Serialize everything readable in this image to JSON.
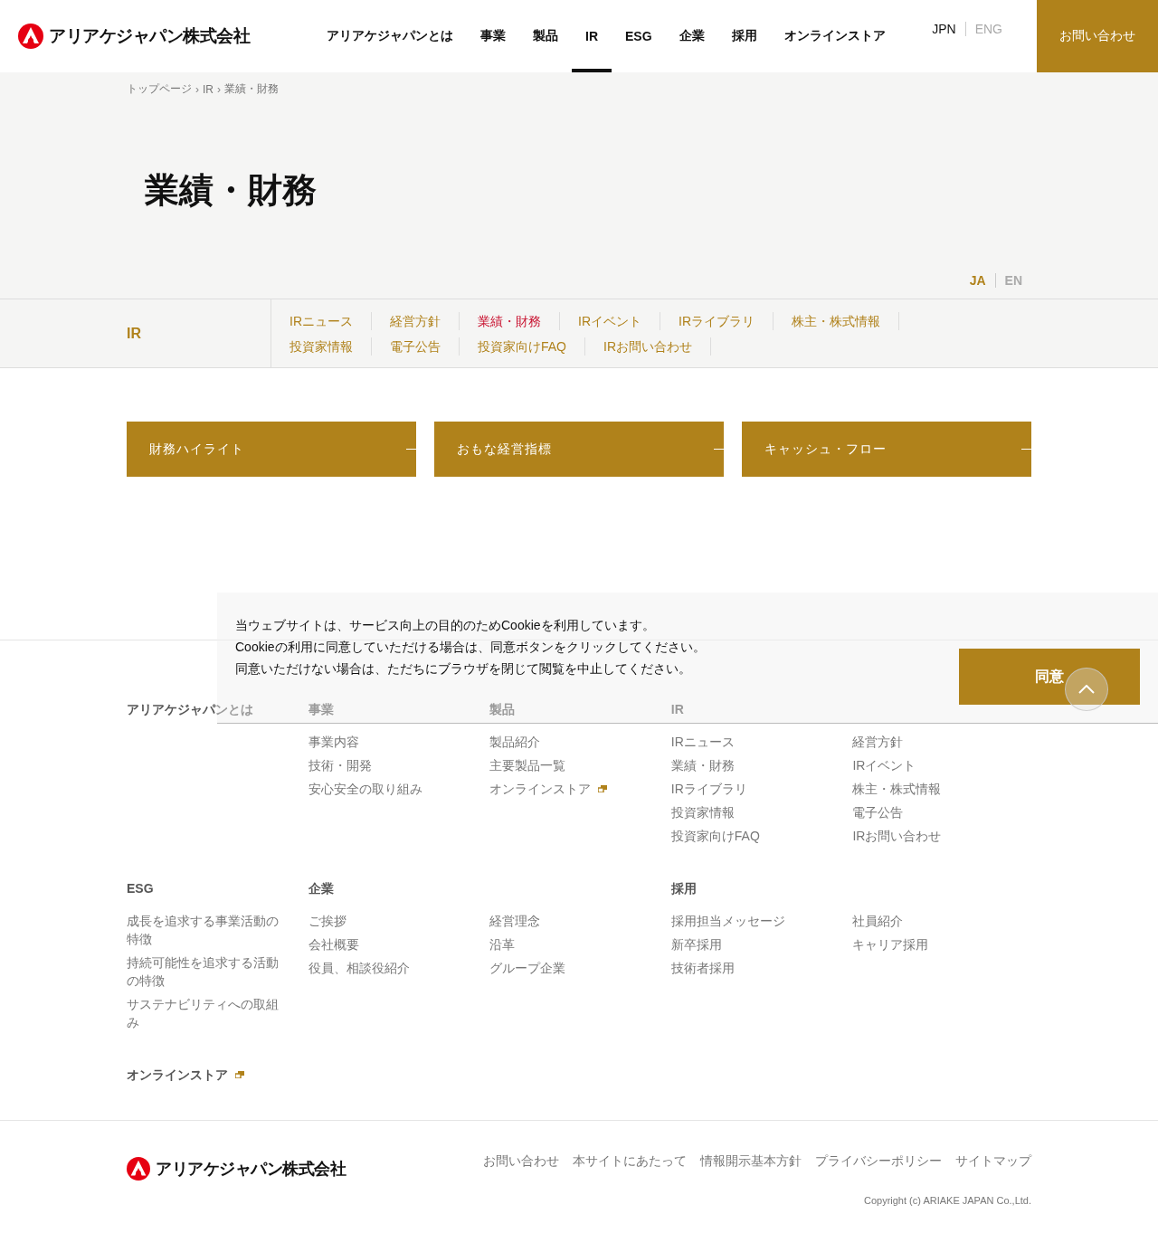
{
  "header": {
    "logo_text": "アリアケジャパン株式会社",
    "nav": [
      {
        "label": "アリアケジャパンとは",
        "selected": false
      },
      {
        "label": "事業",
        "selected": false
      },
      {
        "label": "製品",
        "selected": false
      },
      {
        "label": "IR",
        "selected": true
      },
      {
        "label": "ESG",
        "selected": false
      },
      {
        "label": "企業",
        "selected": false
      },
      {
        "label": "採用",
        "selected": false
      },
      {
        "label": "オンラインストア",
        "selected": false
      }
    ],
    "languages": [
      {
        "label": "JPN",
        "selected": true
      },
      {
        "label": "ENG",
        "selected": false
      }
    ],
    "contact_button": "お問い合わせ"
  },
  "hero": {
    "breadcrumb": [
      "トップページ",
      "IR",
      "業績・財務"
    ],
    "breadcrumb_separator": "›",
    "title": "業績・財務",
    "languages": [
      {
        "label": "JA",
        "selected": true
      },
      {
        "label": "EN",
        "selected": false
      }
    ]
  },
  "subnav": {
    "title": "IR",
    "rows": [
      [
        {
          "label": "IRニュース",
          "selected": false
        },
        {
          "label": "経営方針",
          "selected": false
        },
        {
          "label": "業績・財務",
          "selected": true
        },
        {
          "label": "IRイベント",
          "selected": false
        },
        {
          "label": "IRライブラリ",
          "selected": false
        },
        {
          "label": "株主・株式情報",
          "selected": false
        }
      ],
      [
        {
          "label": "投資家情報",
          "selected": false
        },
        {
          "label": "電子公告",
          "selected": false
        },
        {
          "label": "投資家向けFAQ",
          "selected": false
        },
        {
          "label": "IRお問い合わせ",
          "selected": false
        }
      ]
    ]
  },
  "cards": [
    "財務ハイライト",
    "おもな経営指標",
    "キャッシュ・フロー"
  ],
  "footer_nav": [
    [
      {
        "heading": "アリアケジャパンとは"
      },
      {
        "heading": "事業",
        "columns": [
          [
            {
              "label": "事業内容",
              "external": false
            },
            {
              "label": "技術・開発",
              "external": false
            },
            {
              "label": "安心安全の取り組み",
              "external": false
            }
          ]
        ]
      },
      {
        "heading": "製品",
        "columns": [
          [
            {
              "label": "製品紹介",
              "external": false
            },
            {
              "label": "主要製品一覧",
              "external": false
            },
            {
              "label": "オンラインストア",
              "external": true
            }
          ]
        ]
      },
      {
        "heading": "IR",
        "columns": [
          [
            {
              "label": "IRニュース",
              "external": false
            },
            {
              "label": "業績・財務",
              "external": false
            },
            {
              "label": "IRライブラリ",
              "external": false
            },
            {
              "label": "投資家情報",
              "external": false
            },
            {
              "label": "投資家向けFAQ",
              "external": false
            }
          ],
          [
            {
              "label": "経営方針",
              "external": false
            },
            {
              "label": "IRイベント",
              "external": false
            },
            {
              "label": "株主・株式情報",
              "external": false
            },
            {
              "label": "電子公告",
              "external": false
            },
            {
              "label": "IRお問い合わせ",
              "external": false
            }
          ]
        ]
      }
    ],
    [
      {
        "heading": "ESG",
        "columns": [
          [
            {
              "label": "成長を追求する事業活動の特徴",
              "external": false
            },
            {
              "label": "持続可能性を追求する活動の特徴",
              "external": false
            },
            {
              "label": "サステナビリティへの取組み",
              "external": false
            }
          ]
        ]
      },
      {
        "heading": "企業",
        "columns": [
          [
            {
              "label": "ご挨拶",
              "external": false
            },
            {
              "label": "会社概要",
              "external": false
            },
            {
              "label": "役員、相談役紹介",
              "external": false
            }
          ],
          [
            {
              "label": "経営理念",
              "external": false
            },
            {
              "label": "沿革",
              "external": false
            },
            {
              "label": "グループ企業",
              "external": false
            }
          ]
        ]
      },
      {
        "heading": "採用",
        "columns": [
          [
            {
              "label": "採用担当メッセージ",
              "external": false
            },
            {
              "label": "新卒採用",
              "external": false
            },
            {
              "label": "技術者採用",
              "external": false
            }
          ],
          [
            {
              "label": "社員紹介",
              "external": false
            },
            {
              "label": "キャリア採用",
              "external": false
            }
          ]
        ]
      }
    ]
  ],
  "footer_store": {
    "label": "オンラインストア",
    "external": true
  },
  "footer_bottom": {
    "logo_text": "アリアケジャパン株式会社",
    "links": [
      "お問い合わせ",
      "本サイトにあたって",
      "情報開示基本方針",
      "プライバシーポリシー",
      "サイトマップ"
    ],
    "copyright": "Copyright (c) ARIAKE JAPAN Co.,Ltd."
  },
  "cookie_banner": {
    "lines": [
      "当ウェブサイトは、サービス向上の目的のためCookieを利用しています。",
      "Cookieの利用に同意していただける場合は、同意ボタンをクリックしてください。",
      "同意いただけない場合は、ただちにブラウザを閉じて閲覧を中止してください。"
    ],
    "accept_button": "同意"
  }
}
